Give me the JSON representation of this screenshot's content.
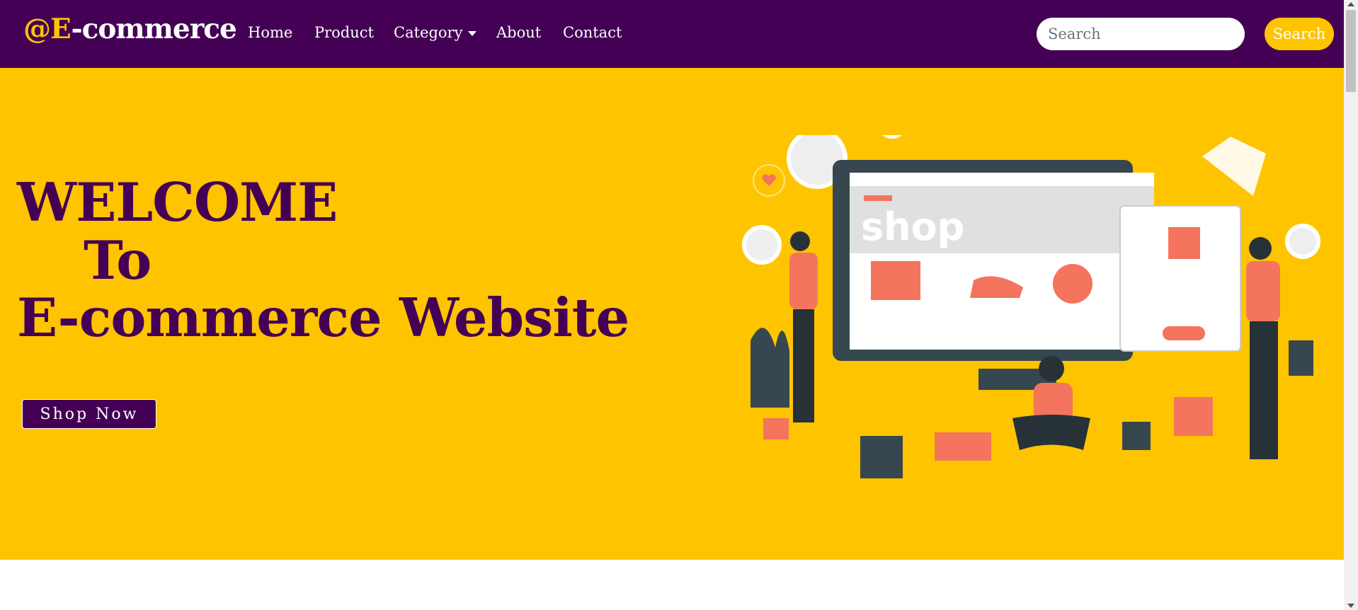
{
  "colors": {
    "primary": "#440055",
    "accent": "#ffc400",
    "coral": "#f4745d",
    "dark": "#37474f"
  },
  "navbar": {
    "brand_prefix": "@E",
    "brand_suffix": "-commerce",
    "links": [
      "Home",
      "Product",
      "Category",
      "About",
      "Contact"
    ],
    "search_placeholder": "Search",
    "search_button": "Search"
  },
  "hero": {
    "line1": "WELCOME",
    "line2": "To",
    "line3": "E-commerce Website",
    "cta": "Shop Now",
    "illustration": {
      "icon": "online-shopping-illustration",
      "screen_text": "shop"
    }
  }
}
